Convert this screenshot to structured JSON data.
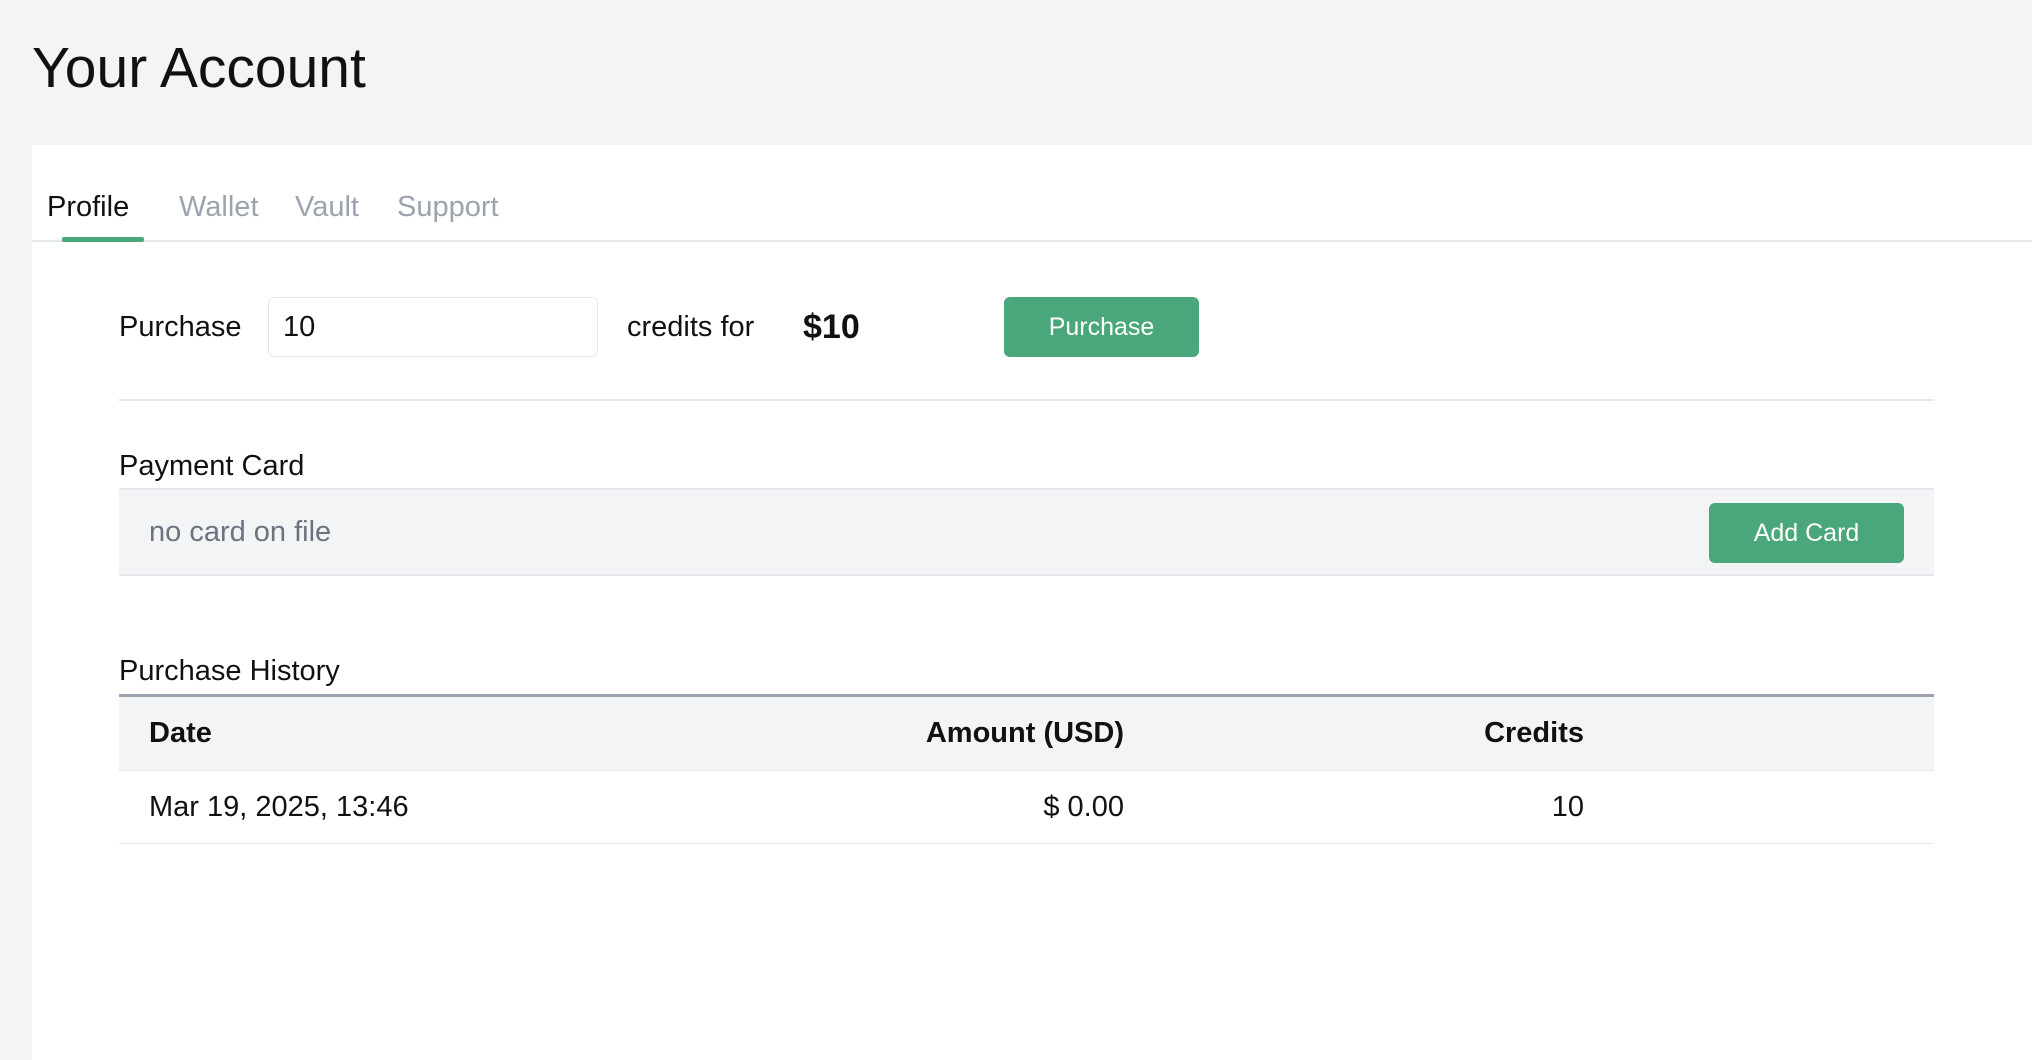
{
  "page": {
    "title": "Your Account"
  },
  "tabs": [
    {
      "label": "Profile",
      "active": true
    },
    {
      "label": "Wallet",
      "active": false
    },
    {
      "label": "Vault",
      "active": false
    },
    {
      "label": "Support",
      "active": false
    }
  ],
  "purchase": {
    "label": "Purchase",
    "credits_value": "10",
    "credits_for_label": "credits for",
    "price": "$10",
    "button_label": "Purchase"
  },
  "payment_card": {
    "title": "Payment Card",
    "status_text": "no card on file",
    "button_label": "Add Card"
  },
  "purchase_history": {
    "title": "Purchase History",
    "columns": [
      "Date",
      "Amount (USD)",
      "Credits"
    ],
    "rows": [
      {
        "date": "Mar 19, 2025, 13:46",
        "amount": "$ 0.00",
        "credits": "10"
      }
    ]
  },
  "colors": {
    "accent": "#4aa67b",
    "background": "#f3f4f6",
    "muted_text": "#6b7280",
    "inactive_tab": "#9ca3af"
  }
}
